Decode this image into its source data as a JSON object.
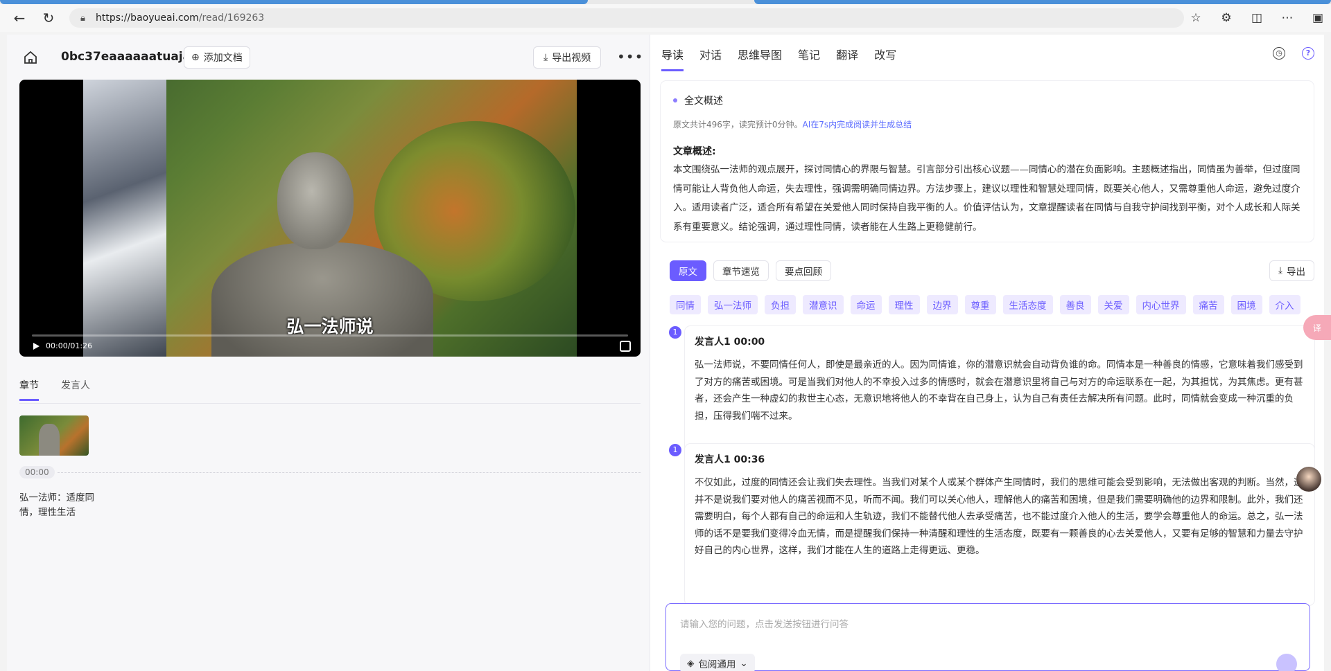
{
  "browser": {
    "url_host": "https://baoyueai.com",
    "url_path": "/read/169263"
  },
  "left": {
    "doc_title": "0bc37eaaaaaatuaja...",
    "add_doc_label": "添加文档",
    "export_video_label": "导出视频",
    "video": {
      "subtitle": "弘一法师说",
      "time": "00:00/01:26"
    },
    "tabs": [
      "章节",
      "发言人"
    ],
    "chapters": [
      {
        "time": "00:00",
        "title": "弘一法师：适度同情，理性生活"
      }
    ]
  },
  "right": {
    "tabs": [
      "导读",
      "对话",
      "思维导图",
      "笔记",
      "翻译",
      "改写"
    ],
    "overview": {
      "heading": "全文概述",
      "meta": "原文共计496字，读完预计0分钟。",
      "meta_ai": "AI在7s内完成阅读并生成总结",
      "label": "文章概述:",
      "body": "本文围绕弘一法师的观点展开，探讨同情心的界限与智慧。引言部分引出核心议题——同情心的潜在负面影响。主题概述指出，同情虽为善举，但过度同情可能让人背负他人命运，失去理性，强调需明确同情边界。方法步骤上，建议以理性和智慧处理同情，既要关心他人，又需尊重他人命运，避免过度介入。适用读者广泛，适合所有希望在关爱他人同时保持自我平衡的人。价值评估认为，文章提醒读者在同情与自我守护间找到平衡，对个人成长和人际关系有重要意义。结论强调，通过理性同情，读者能在人生路上更稳健前行。"
    },
    "segments": [
      "原文",
      "章节速览",
      "要点回顾"
    ],
    "export_label": "导出",
    "tags": [
      "同情",
      "弘一法师",
      "负担",
      "潜意识",
      "命运",
      "理性",
      "边界",
      "尊重",
      "生活态度",
      "善良",
      "关爱",
      "内心世界",
      "痛苦",
      "困境",
      "介入"
    ],
    "transcript": [
      {
        "badge": "1",
        "speaker": "发言人1 00:00",
        "text": "弘一法师说，不要同情任何人，即使是最亲近的人。因为同情谁，你的潜意识就会自动背负谁的命。同情本是一种善良的情感，它意味着我们感受到了对方的痛苦或困境。可是当我们对他人的不幸投入过多的情感时，就会在潜意识里将自己与对方的命运联系在一起，为其担忧，为其焦虑。更有甚者，还会产生一种虚幻的救世主心态，无意识地将他人的不幸背在自己身上，认为自己有责任去解决所有问题。此时，同情就会变成一种沉重的负担，压得我们喘不过来。"
      },
      {
        "badge": "1",
        "speaker": "发言人1 00:36",
        "text": "不仅如此，过度的同情还会让我们失去理性。当我们对某个人或某个群体产生同情时，我们的思维可能会受到影响，无法做出客观的判断。当然，这并不是说我们要对他人的痛苦视而不见，听而不闻。我们可以关心他人，理解他人的痛苦和困境，但是我们需要明确他的边界和限制。此外，我们还需要明白，每个人都有自己的命运和人生轨迹，我们不能替代他人去承受痛苦，也不能过度介入他人的生活，要学会尊重他人的命运。总之，弘一法师的话不是要我们变得冷血无情，而是提醒我们保持一种清醒和理性的生活态度，既要有一颗善良的心去关爱他人，又要有足够的智慧和力量去守护好自己的内心世界，这样，我们才能在人生的道路上走得更远、更稳。"
      }
    ],
    "ask_placeholder": "请输入您的问题，点击发送按钮进行问答",
    "ask_mode": "包阅通用"
  }
}
